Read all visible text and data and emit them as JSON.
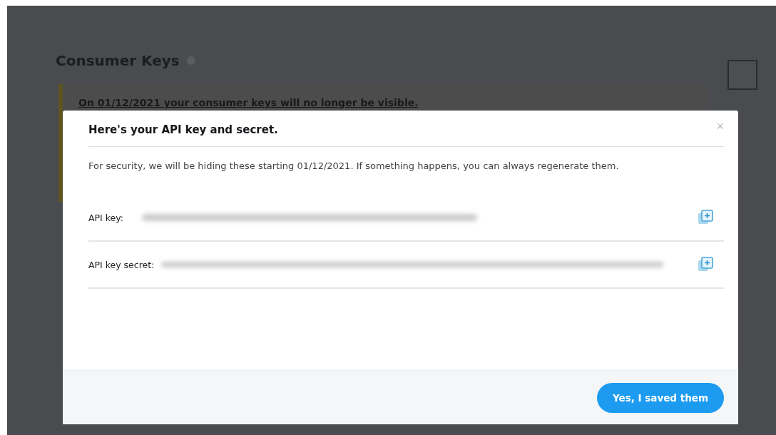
{
  "page": {
    "title": "Consumer Keys",
    "notice": "On 01/12/2021 your consumer keys will no longer be visible."
  },
  "modal": {
    "title": "Here's your API key and secret.",
    "close": "×",
    "message": "For security, we will be hiding these starting 01/12/2021. If something happens, you can always regenerate them.",
    "fields": [
      {
        "label": "API key:",
        "kind": "short"
      },
      {
        "label": "API key secret:",
        "kind": "long"
      }
    ],
    "confirm": "Yes, I saved them"
  }
}
